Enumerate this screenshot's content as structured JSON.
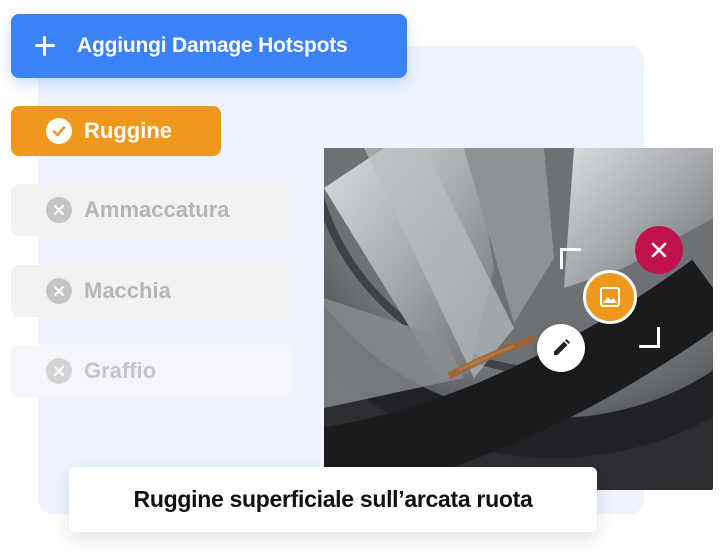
{
  "header": {
    "add_button_label": "Aggiungi Damage Hotspots"
  },
  "tags": [
    {
      "label": "Ruggine",
      "state": "selected"
    },
    {
      "label": "Ammaccatura",
      "state": "unselected"
    },
    {
      "label": "Macchia",
      "state": "unselected"
    },
    {
      "label": "Graffio",
      "state": "unselected"
    }
  ],
  "caption": {
    "text": "Ruggine superficiale sull’arcata ruota"
  },
  "hotspot": {
    "icons": [
      "image-icon",
      "close-icon",
      "pencil-icon"
    ]
  },
  "colors": {
    "primary": "#3b82f6",
    "accent": "#f0981c",
    "danger": "#c0124a",
    "panel_bg": "#eef3fd"
  }
}
